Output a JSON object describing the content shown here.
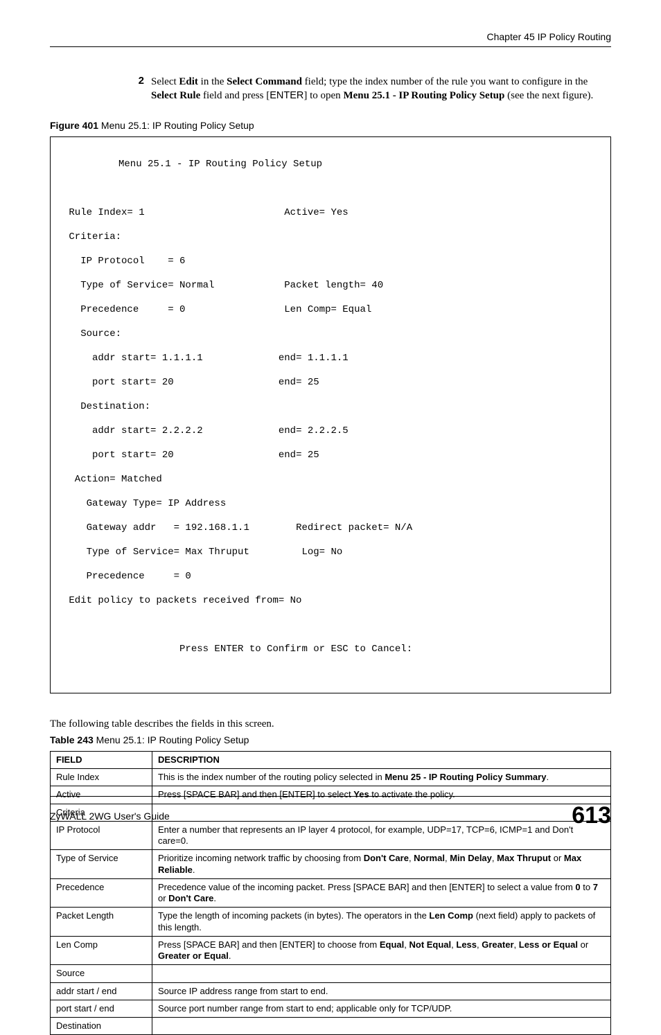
{
  "header": {
    "chapter": "Chapter 45 IP Policy Routing"
  },
  "step": {
    "number": "2",
    "t1": "Select ",
    "edit": "Edit",
    "t2": " in the ",
    "selcmd": "Select Command",
    "t3": " field; type the index number of the rule you want to configure in the ",
    "selrule": "Select Rule",
    "t4": " field and press [",
    "enter": "ENTER",
    "t5": "] to open ",
    "menu": "Menu 25.1 - IP Routing Policy Setup",
    "t6": " (see the next figure)."
  },
  "figure": {
    "label": "Figure 401",
    "caption": "   Menu 25.1: IP Routing Policy Setup"
  },
  "terminal": {
    "title": "Menu 25.1 - IP Routing Policy Setup",
    "l1a": " Rule Index= 1",
    "l1b": "Active= Yes",
    "l2": " Criteria:",
    "l3": "   IP Protocol    = 6",
    "l4a": "   Type of Service= Normal",
    "l4b": "Packet length= 40",
    "l5a": "   Precedence     = 0",
    "l5b": " Len Comp= Equal",
    "l6": "   Source:",
    "l7a": "     addr start= 1.1.1.1",
    "l7b": "end= 1.1.1.1",
    "l8a": "     port start= 20",
    "l8b": "end= 25",
    "l9": "   Destination:",
    "l10a": "     addr start= 2.2.2.2",
    "l10b": "end= 2.2.2.5",
    "l11a": "     port start= 20",
    "l11b": "end= 25",
    "l12": "  Action= Matched",
    "l13": "    Gateway Type= IP Address",
    "l14a": "    Gateway addr   = 192.168.1.1",
    "l14b": "Redirect packet= N/A",
    "l15a": "    Type of Service= Max Thruput",
    "l15b": " Log= No",
    "l16": "    Precedence     = 0",
    "l17": " Edit policy to packets received from= No",
    "l18": "                    Press ENTER to Confirm or ESC to Cancel:"
  },
  "intro": "The following table describes the fields in this screen.",
  "table": {
    "label": "Table 243",
    "caption": "   Menu 25.1: IP Routing Policy Setup",
    "headField": "FIELD",
    "headDesc": "DESCRIPTION",
    "rows": [
      {
        "field": "Rule Index",
        "d1": "This is the index number of the routing policy selected in ",
        "b1": "Menu 25 - IP Routing Policy Summary",
        "d2": "."
      },
      {
        "field": "Active",
        "d1": "Press [SPACE BAR] and then [ENTER] to select ",
        "b1": "Yes",
        "d2": " to activate the policy."
      },
      {
        "field": "Criteria",
        "d1": "",
        "b1": "",
        "d2": ""
      },
      {
        "field": "IP Protocol",
        "d1": "Enter a number that represents an IP layer 4 protocol, for example, UDP=17, TCP=6, ICMP=1 and Don't care=0.",
        "b1": "",
        "d2": ""
      },
      {
        "field": "Type of Service",
        "d1": "Prioritize incoming network traffic by choosing from ",
        "b1": "Don't Care",
        "d2": ", ",
        "b2": "Normal",
        "d3": ", ",
        "b3": "Min Delay",
        "d4": ", ",
        "b4": "Max Thruput",
        "d5": " or ",
        "b5": "Max Reliable",
        "d6": "."
      },
      {
        "field": "Precedence",
        "d1": "Precedence value of the incoming packet. Press [SPACE BAR] and then [ENTER] to select a value from ",
        "b1": "0",
        "d2": " to ",
        "b2": "7",
        "d3": " or ",
        "b3": "Don't Care",
        "d4": "."
      },
      {
        "field": "Packet Length",
        "d1": "Type the length of incoming packets (in bytes). The operators in the ",
        "b1": "Len Comp",
        "d2": " (next field) apply to packets of this length."
      },
      {
        "field": "Len Comp",
        "d1": "Press [SPACE BAR] and then [ENTER] to choose from ",
        "b1": "Equal",
        "d2": ", ",
        "b2": "Not Equal",
        "d3": ", ",
        "b3": "Less",
        "d4": ", ",
        "b4": "Greater",
        "d5": ", ",
        "b5": "Less or Equal",
        "d6": " or ",
        "b6": "Greater or Equal",
        "d7": "."
      },
      {
        "field": "Source",
        "d1": "",
        "b1": "",
        "d2": ""
      },
      {
        "field": "addr start / end",
        "d1": "Source IP address range from start to end.",
        "b1": "",
        "d2": ""
      },
      {
        "field": "port start / end",
        "d1": "Source port number range from start to end; applicable only for TCP/UDP.",
        "b1": "",
        "d2": ""
      },
      {
        "field": "Destination",
        "d1": "",
        "b1": "",
        "d2": ""
      }
    ]
  },
  "footer": {
    "guide": "ZyWALL 2WG User's Guide",
    "page": "613"
  }
}
